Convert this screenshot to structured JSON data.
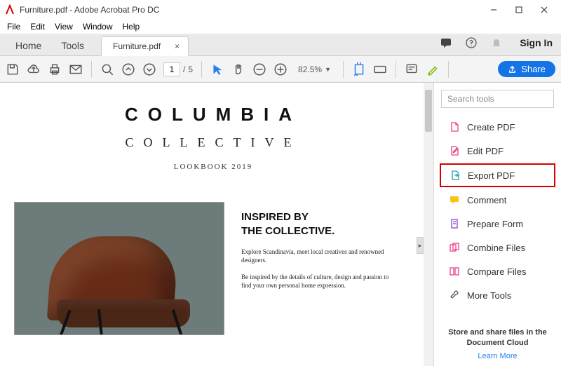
{
  "window": {
    "title": "Furniture.pdf - Adobe Acrobat Pro DC"
  },
  "menu": {
    "file": "File",
    "edit": "Edit",
    "view": "View",
    "window": "Window",
    "help": "Help"
  },
  "top": {
    "home": "Home",
    "tools": "Tools",
    "tab_label": "Furniture.pdf",
    "signin": "Sign In"
  },
  "toolbar": {
    "page_current": "1",
    "page_sep": "/",
    "page_total": "5",
    "zoom": "82.5%",
    "share": "Share"
  },
  "doc": {
    "brand": "COLUMBIA",
    "sub": "COLLECTIVE",
    "lookbook": "LOOKBOOK 2019",
    "headline1": "INSPIRED BY",
    "headline2": "THE COLLECTIVE.",
    "para1": "Explore Scandinavia, meet local creatives and renowned designers.",
    "para2": "Be inspired by the details of culture, design and passion to find your own personal home expression."
  },
  "panel": {
    "search_placeholder": "Search tools",
    "items": [
      {
        "label": "Create PDF"
      },
      {
        "label": "Edit PDF"
      },
      {
        "label": "Export PDF"
      },
      {
        "label": "Comment"
      },
      {
        "label": "Prepare Form"
      },
      {
        "label": "Combine Files"
      },
      {
        "label": "Compare Files"
      },
      {
        "label": "More Tools"
      }
    ],
    "promo_line1": "Store and share files in the",
    "promo_line2": "Document Cloud",
    "promo_link": "Learn More"
  },
  "colors": {
    "accent": "#1473e6",
    "highlight_border": "#d40000",
    "tool_pink": "#ec3e8b",
    "tool_purple": "#8b3ecf",
    "tool_teal": "#1aa3a3",
    "tool_yellow": "#f5c518"
  }
}
